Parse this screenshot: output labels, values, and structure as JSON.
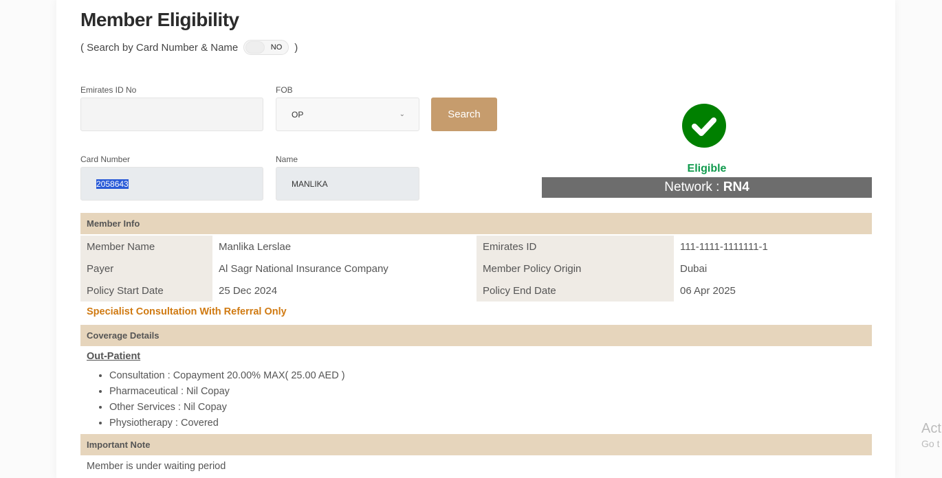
{
  "title": "Member Eligibility",
  "search_toggle": {
    "label": "( Search by Card Number & Name",
    "state": "NO",
    "close": ")"
  },
  "form": {
    "emirates_id": {
      "label": "Emirates ID No",
      "value": ""
    },
    "fob": {
      "label": "FOB",
      "value": "OP"
    },
    "search_button": "Search",
    "card_number": {
      "label": "Card Number",
      "value": "2058643"
    },
    "name": {
      "label": "Name",
      "value": "MANLIKA"
    }
  },
  "status": {
    "text": "Eligible",
    "network_label": "Network : ",
    "network_value": "RN4",
    "color": "#008000"
  },
  "member_info": {
    "header": "Member Info",
    "rows": [
      {
        "k1": "Member Name",
        "v1": "Manlika Lerslae",
        "k2": "Emirates ID",
        "v2": "111-1111-1111111-1"
      },
      {
        "k1": "Payer",
        "v1": "Al Sagr National Insurance Company",
        "k2": "Member Policy Origin",
        "v2": "Dubai"
      },
      {
        "k1": "Policy Start Date",
        "v1": "25 Dec 2024",
        "k2": "Policy End Date",
        "v2": "06 Apr 2025"
      }
    ],
    "warning": "Specialist Consultation With Referral Only"
  },
  "coverage": {
    "header": "Coverage Details",
    "section": "Out-Patient",
    "items": [
      "Consultation : Copayment 20.00% MAX( 25.00 AED )",
      "Pharmaceutical : Nil Copay",
      "Other Services : Nil Copay",
      "Physiotherapy : Covered"
    ]
  },
  "note": {
    "header": "Important Note",
    "text": "Member is under waiting period"
  },
  "watermark": {
    "line1": "Act",
    "line2": "Go t"
  }
}
